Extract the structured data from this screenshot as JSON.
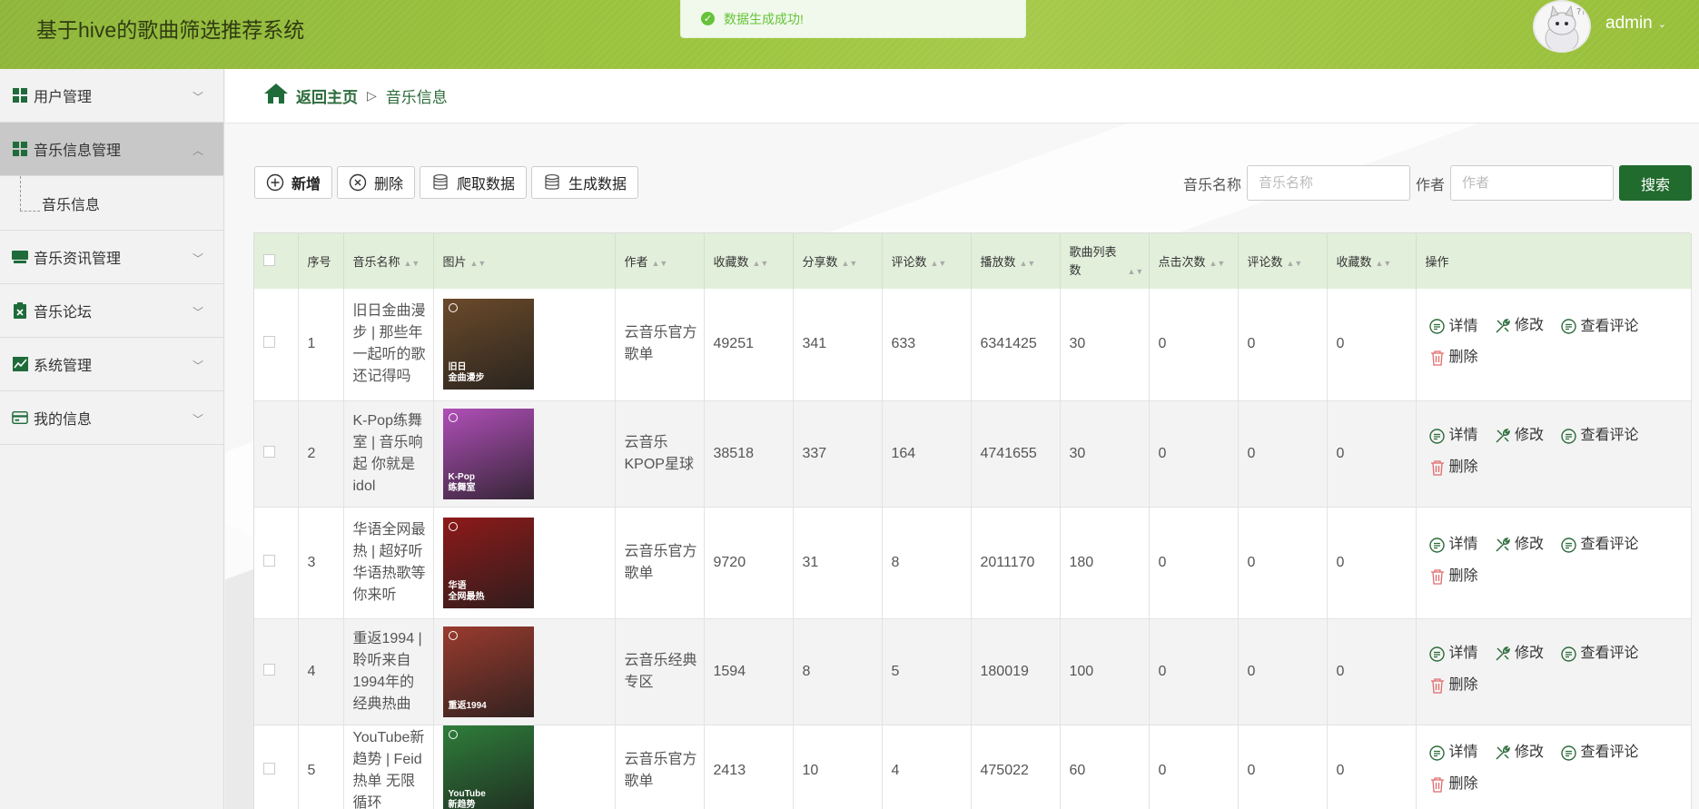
{
  "header": {
    "title": "基于hive的歌曲筛选推荐系统",
    "toast": "数据生成成功!",
    "user": "admin"
  },
  "sidebar": {
    "items": [
      {
        "label": "用户管理",
        "icon": "grid-icon"
      },
      {
        "label": "音乐信息管理",
        "icon": "grid-icon"
      },
      {
        "label": "音乐资讯管理",
        "icon": "monitor-icon"
      },
      {
        "label": "音乐论坛",
        "icon": "clipboard-icon"
      },
      {
        "label": "系统管理",
        "icon": "chart-icon"
      },
      {
        "label": "我的信息",
        "icon": "card-icon"
      }
    ],
    "sub_active": "音乐信息"
  },
  "breadcrumb": {
    "home": "返回主页",
    "sep": "▷",
    "current": "音乐信息"
  },
  "toolbar": {
    "add": "新增",
    "delete": "删除",
    "crawl": "爬取数据",
    "generate": "生成数据"
  },
  "search": {
    "name_label": "音乐名称",
    "name_placeholder": "音乐名称",
    "author_label": "作者",
    "author_placeholder": "作者",
    "button": "搜索"
  },
  "table": {
    "headers": [
      "序号",
      "音乐名称",
      "图片",
      "作者",
      "收藏数",
      "分享数",
      "评论数",
      "播放数",
      "歌曲列表数",
      "点击次数",
      "评论数",
      "收藏数",
      "操作"
    ],
    "actions": {
      "detail": "详情",
      "edit": "修改",
      "comments": "查看评论",
      "delete": "删除"
    },
    "rows": [
      {
        "no": "1",
        "name": "旧日金曲漫步 | 那些年一起听的歌 还记得吗",
        "img_caption": "旧日\n金曲漫步",
        "img_color": "#6b4a2a",
        "author": "云音乐官方歌单",
        "fav": "49251",
        "share": "341",
        "comment": "633",
        "play": "6341425",
        "songs": "30",
        "clicks": "0",
        "comments2": "0",
        "favs2": "0"
      },
      {
        "no": "2",
        "name": "K-Pop练舞室 | 音乐响起 你就是idol",
        "img_caption": "K-Pop\n练舞室",
        "img_color": "#b04fb8",
        "author": "云音乐KPOP星球",
        "fav": "38518",
        "share": "337",
        "comment": "164",
        "play": "4741655",
        "songs": "30",
        "clicks": "0",
        "comments2": "0",
        "favs2": "0"
      },
      {
        "no": "3",
        "name": "华语全网最热 | 超好听华语热歌等你来听",
        "img_caption": "华语\n全网最热",
        "img_color": "#8e1a1a",
        "author": "云音乐官方歌单",
        "fav": "9720",
        "share": "31",
        "comment": "8",
        "play": "2011170",
        "songs": "180",
        "clicks": "0",
        "comments2": "0",
        "favs2": "0"
      },
      {
        "no": "4",
        "name": "重返1994 | 聆听来自1994年的经典热曲",
        "img_caption": "重返1994",
        "img_color": "#9a3b2e",
        "author": "云音乐经典专区",
        "fav": "1594",
        "share": "8",
        "comment": "5",
        "play": "180019",
        "songs": "100",
        "clicks": "0",
        "comments2": "0",
        "favs2": "0"
      },
      {
        "no": "5",
        "name": "YouTube新趋势 | Feid热单 无限循环",
        "img_caption": "YouTube\n新趋势",
        "img_color": "#2e7d3a",
        "author": "云音乐官方歌单",
        "fav": "2413",
        "share": "10",
        "comment": "4",
        "play": "475022",
        "songs": "60",
        "clicks": "0",
        "comments2": "0",
        "favs2": "0"
      }
    ]
  }
}
